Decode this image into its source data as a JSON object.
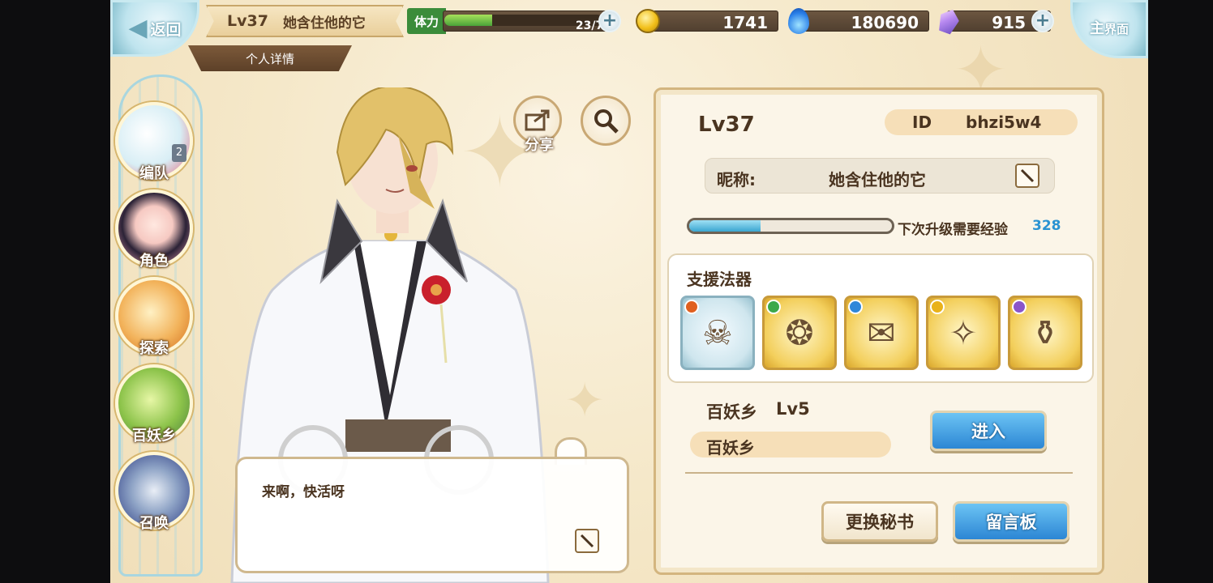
{
  "header": {
    "back_label": "返回",
    "level": "Lv37",
    "player_name": "她含住他的它",
    "subtitle": "个人详情",
    "home_label_1": "主",
    "home_label_2": "界面"
  },
  "resources": {
    "stamina_label": "体力",
    "stamina_text": "23/76",
    "stamina_fraction": 0.3,
    "gold": "1741",
    "soul": "180690",
    "gems": "915"
  },
  "nav": {
    "items": [
      {
        "label": "编队",
        "badge": "2"
      },
      {
        "label": "角色"
      },
      {
        "label": "探索"
      },
      {
        "label": "百妖乡"
      },
      {
        "label": "召唤"
      }
    ]
  },
  "actions": {
    "share_label": "分享"
  },
  "speech": {
    "text": "来啊，快活呀"
  },
  "profile": {
    "level": "Lv37",
    "id_key": "ID",
    "id_value": "bhzi5w4",
    "nickname_key": "昵称:",
    "nickname_value": "她含住他的它",
    "exp_label": "下次升级需要经验",
    "exp_value": "328",
    "exp_fraction": 0.35,
    "artifact_title": "支援法器",
    "artifacts": [
      {
        "name": "skull-heart-artifact",
        "frame": "blue",
        "dot_color": "#e0601f"
      },
      {
        "name": "crystal-crescent-artifact",
        "frame": "gold",
        "dot_color": "#3ba84a"
      },
      {
        "name": "scroll-artifact",
        "frame": "gold",
        "dot_color": "#2f87d9"
      },
      {
        "name": "blade-artifact",
        "frame": "gold",
        "dot_color": "#e9b21a"
      },
      {
        "name": "pot-artifact",
        "frame": "gold",
        "dot_color": "#8a55c9"
      }
    ],
    "village_name": "百妖乡",
    "village_level": "Lv5",
    "village_tag": "百妖乡",
    "enter_label": "进入",
    "change_secretary_label": "更换秘书",
    "message_board_label": "留言板"
  }
}
